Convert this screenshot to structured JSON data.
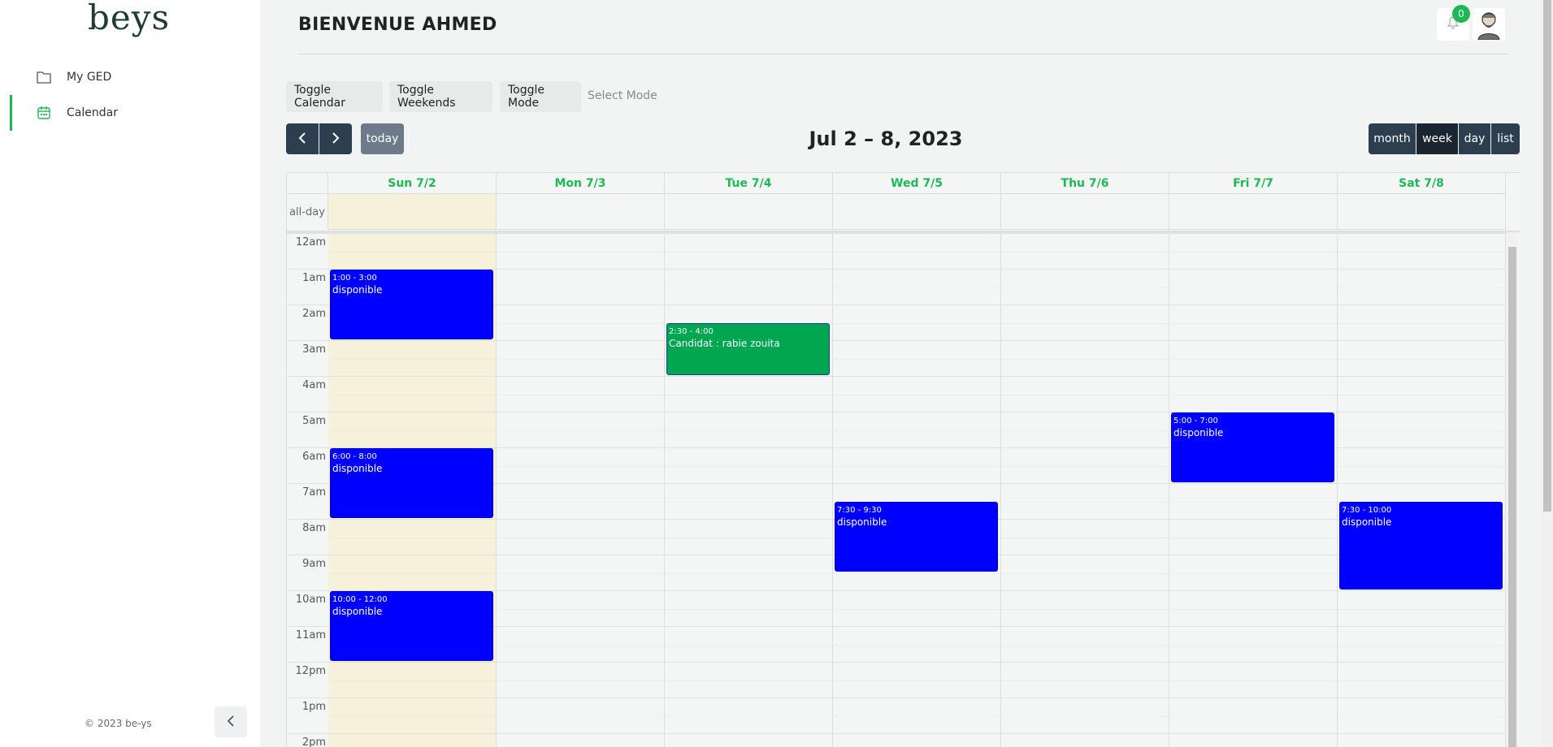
{
  "sidebar": {
    "logo": "beys",
    "items": [
      {
        "label": "My GED",
        "icon": "folder-icon"
      },
      {
        "label": "Calendar",
        "icon": "calendar-icon"
      }
    ],
    "copyright": "© 2023 be-ys"
  },
  "header": {
    "title": "BIENVENUE AHMED",
    "notification_count": "0"
  },
  "toolbar": {
    "toggle_calendar": "Toggle Calendar",
    "toggle_weekends": "Toggle Weekends",
    "toggle_mode": "Toggle Mode",
    "select_mode": "Select Mode"
  },
  "calendar": {
    "prev": "‹",
    "next": "›",
    "today": "today",
    "range_title": "Jul 2 – 8, 2023",
    "views": [
      "month",
      "week",
      "day",
      "list"
    ],
    "active_view": "week",
    "all_day_label": "all-day",
    "days": [
      "Sun 7/2",
      "Mon 7/3",
      "Tue 7/4",
      "Wed 7/5",
      "Thu 7/6",
      "Fri 7/7",
      "Sat 7/8"
    ],
    "hours": [
      "12am",
      "1am",
      "2am",
      "3am",
      "4am",
      "5am",
      "6am",
      "7am",
      "8am",
      "9am",
      "10am",
      "11am",
      "12pm",
      "1pm",
      "2pm"
    ],
    "events": [
      {
        "day": 0,
        "start": 1.0,
        "end": 3.0,
        "time": "1:00 - 3:00",
        "title": "disponible",
        "color": "#0000ff"
      },
      {
        "day": 0,
        "start": 6.0,
        "end": 8.0,
        "time": "6:00 - 8:00",
        "title": "disponible",
        "color": "#0000ff"
      },
      {
        "day": 0,
        "start": 10.0,
        "end": 12.0,
        "time": "10:00 - 12:00",
        "title": "disponible",
        "color": "#0000ff"
      },
      {
        "day": 2,
        "start": 2.5,
        "end": 4.0,
        "time": "2:30 - 4:00",
        "title": "Candidat : rabie zouita",
        "color": "#00a650"
      },
      {
        "day": 3,
        "start": 7.5,
        "end": 9.5,
        "time": "7:30 - 9:30",
        "title": "disponible",
        "color": "#0000ff"
      },
      {
        "day": 5,
        "start": 5.0,
        "end": 7.0,
        "time": "5:00 - 7:00",
        "title": "disponible",
        "color": "#0000ff"
      },
      {
        "day": 6,
        "start": 7.5,
        "end": 10.0,
        "time": "7:30 - 10:00",
        "title": "disponible",
        "color": "#0000ff"
      }
    ]
  }
}
